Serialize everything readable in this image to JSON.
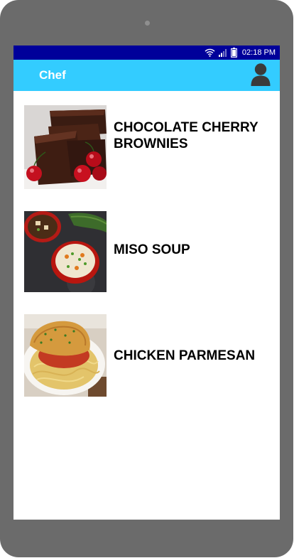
{
  "status_bar": {
    "time": "02:18 PM",
    "icons": [
      "wifi-icon",
      "signal-icon",
      "battery-icon"
    ]
  },
  "app_bar": {
    "title": "Chef",
    "profile_icon": "user-icon"
  },
  "recipes": [
    {
      "title": "CHOCOLATE CHERRY BROWNIES"
    },
    {
      "title": "MISO SOUP"
    },
    {
      "title": "CHICKEN PARMESAN"
    }
  ],
  "colors": {
    "status_bar": "#00009a",
    "app_bar": "#33ccff",
    "device_frame": "#6b6b6b"
  }
}
